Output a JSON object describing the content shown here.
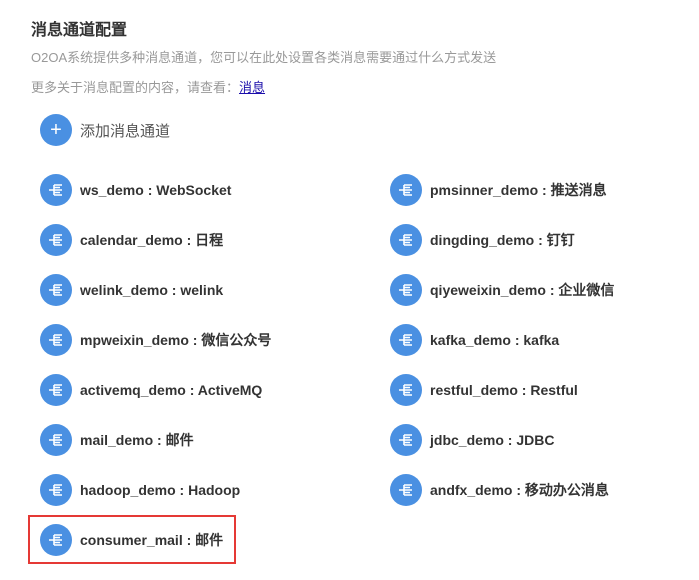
{
  "header": {
    "title": "消息通道配置",
    "description": "O2OA系统提供多种消息通道，您可以在此处设置各类消息需要通过什么方式发送",
    "more_prefix": "更多关于消息配置的内容，请查看：",
    "more_link": "消息"
  },
  "add_channel": {
    "icon": "plus-icon",
    "label": "添加消息通道"
  },
  "channels": [
    {
      "label": "ws_demo : WebSocket",
      "icon": "channel-icon"
    },
    {
      "label": "pmsinner_demo : 推送消息",
      "icon": "channel-icon"
    },
    {
      "label": "calendar_demo : 日程",
      "icon": "channel-icon"
    },
    {
      "label": "dingding_demo : 钉钉",
      "icon": "channel-icon"
    },
    {
      "label": "welink_demo : welink",
      "icon": "channel-icon"
    },
    {
      "label": "qiyeweixin_demo : 企业微信",
      "icon": "channel-icon"
    },
    {
      "label": "mpweixin_demo : 微信公众号",
      "icon": "channel-icon"
    },
    {
      "label": "kafka_demo : kafka",
      "icon": "channel-icon"
    },
    {
      "label": "activemq_demo : ActiveMQ",
      "icon": "channel-icon"
    },
    {
      "label": "restful_demo : Restful",
      "icon": "channel-icon"
    },
    {
      "label": "mail_demo : 邮件",
      "icon": "channel-icon"
    },
    {
      "label": "jdbc_demo : JDBC",
      "icon": "channel-icon"
    },
    {
      "label": "hadoop_demo : Hadoop",
      "icon": "channel-icon"
    },
    {
      "label": "andfx_demo : 移动办公消息",
      "icon": "channel-icon"
    },
    {
      "label": "consumer_mail : 邮件",
      "icon": "channel-icon"
    }
  ],
  "colors": {
    "accent": "#4a90e2",
    "highlight": "#e53935",
    "link": "#1a0dab"
  }
}
